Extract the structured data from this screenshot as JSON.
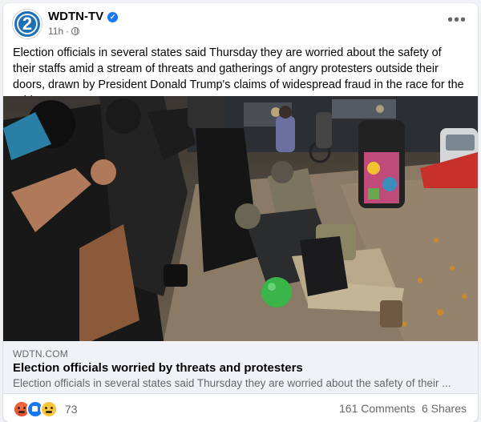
{
  "post": {
    "page_name": "WDTN-TV",
    "avatar_text": "2",
    "timestamp": "11h",
    "meta_separator": "·",
    "text": "Election officials in several states said Thursday they are worried about the safety of their staffs amid a stream of threats and gatherings of angry protesters outside their doors, drawn by President Donald Trump's claims of widespread fraud in the race for the White House."
  },
  "link_preview": {
    "domain": "WDTN.COM",
    "title": "Election officials worried by threats and protesters",
    "description": "Election officials in several states said Thursday they are worried about the safety of their ..."
  },
  "footer": {
    "reaction_count": "73",
    "comments": "161 Comments",
    "shares": "6 Shares"
  },
  "icons": {
    "verified": "verified-badge-icon",
    "privacy": "globe-icon",
    "more": "more-options-icon",
    "reactions": [
      "angry-reaction-icon",
      "like-reaction-icon",
      "haha-reaction-icon"
    ]
  },
  "colors": {
    "accent": "#1877f2",
    "avatar": "#1f6fb3",
    "secondary_text": "#65676b",
    "background": "#f0f2f5"
  }
}
